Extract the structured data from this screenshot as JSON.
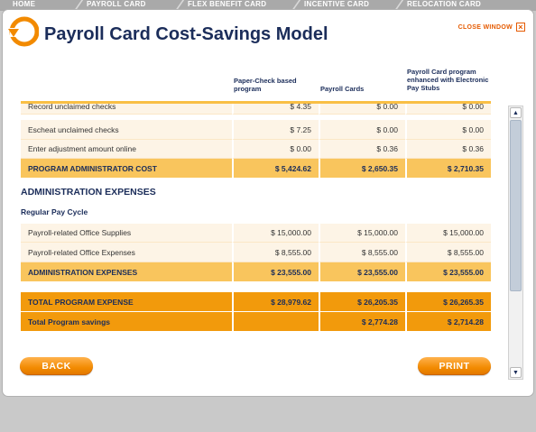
{
  "tabs": [
    "HOME",
    "PAYROLL CARD",
    "FLEX BENEFIT CARD",
    "INCENTIVE CARD",
    "RELOCATION CARD"
  ],
  "header": {
    "title": "Payroll Card Cost-Savings Model",
    "close_label": "CLOSE WINDOW",
    "close_icon": "×"
  },
  "columns": {
    "col1": "Paper-Check based program",
    "col2": "Payroll Cards",
    "col3": "Payroll Card program enhanced with Electronic Pay Stubs"
  },
  "rows": {
    "record_unclaimed": {
      "label": "Record unclaimed checks",
      "v1": "$ 4.35",
      "v2": "$ 0.00",
      "v3": "$ 0.00"
    },
    "escheat_unclaimed": {
      "label": "Escheat unclaimed checks",
      "v1": "$ 7.25",
      "v2": "$ 0.00",
      "v3": "$ 0.00"
    },
    "enter_adjustment": {
      "label": "Enter adjustment amount online",
      "v1": "$ 0.00",
      "v2": "$ 0.36",
      "v3": "$ 0.36"
    },
    "program_admin_cost": {
      "label": "PROGRAM ADMINISTRATOR COST",
      "v1": "$ 5,424.62",
      "v2": "$ 2,650.35",
      "v3": "$ 2,710.35"
    },
    "office_supplies": {
      "label": "Payroll-related Office Supplies",
      "v1": "$ 15,000.00",
      "v2": "$ 15,000.00",
      "v3": "$ 15,000.00"
    },
    "office_expenses": {
      "label": "Payroll-related Office Expenses",
      "v1": "$ 8,555.00",
      "v2": "$ 8,555.00",
      "v3": "$ 8,555.00"
    },
    "admin_expenses_total": {
      "label": "ADMINISTRATION EXPENSES",
      "v1": "$ 23,555.00",
      "v2": "$ 23,555.00",
      "v3": "$ 23,555.00"
    },
    "total_program_expense": {
      "label": "TOTAL PROGRAM EXPENSE",
      "v1": "$ 28,979.62",
      "v2": "$ 26,205.35",
      "v3": "$ 26,265.35"
    },
    "total_program_savings": {
      "label": "Total Program savings",
      "v1": "",
      "v2": "$ 2,774.28",
      "v3": "$ 2,714.28"
    }
  },
  "sections": {
    "admin_expenses": "ADMINISTRATION EXPENSES",
    "regular_pay_cycle": "Regular Pay Cycle"
  },
  "buttons": {
    "back": "BACK",
    "print": "PRINT"
  },
  "colors": {
    "accent": "#f28a00",
    "title": "#1b2d5a",
    "row_light": "#fdf4e6",
    "row_yellow": "#f9c55d",
    "row_orange": "#f29a0c"
  }
}
